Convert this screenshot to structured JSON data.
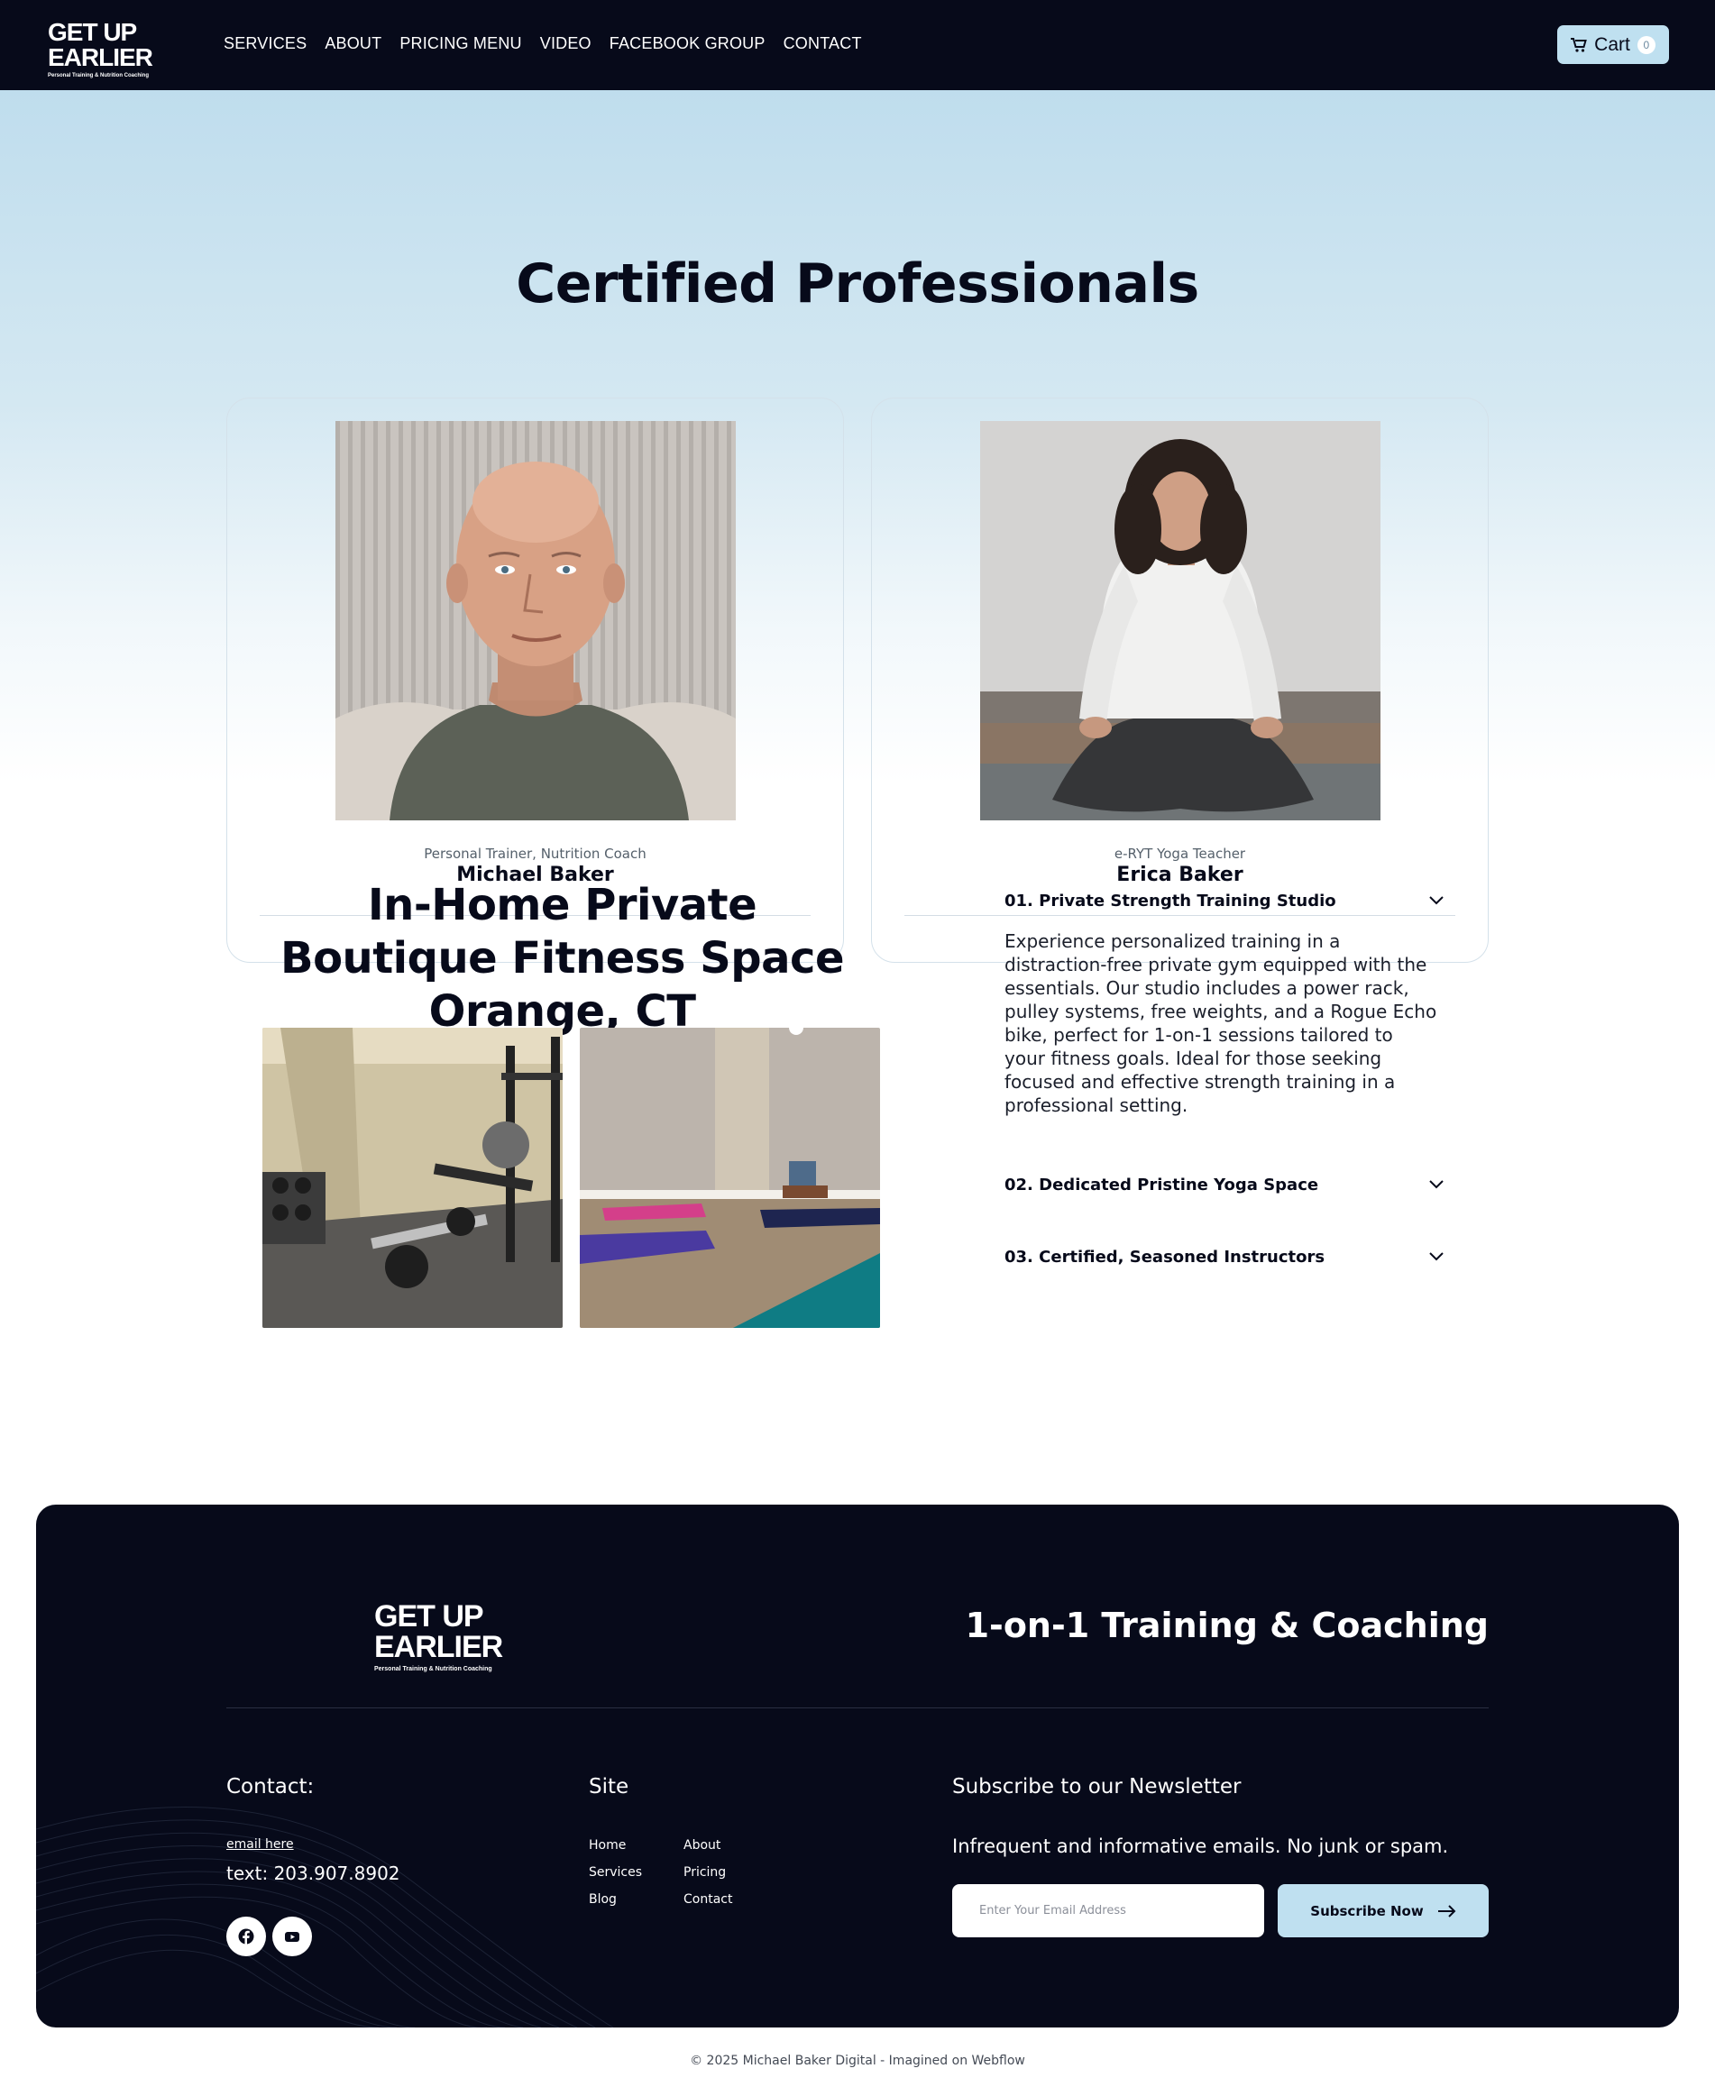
{
  "brand": {
    "logo_line1": "GET UP",
    "logo_line2": "EARLIER",
    "logo_tagline": "Personal Training & Nutrition Coaching"
  },
  "nav": {
    "items": [
      "SERVICES",
      "ABOUT",
      "PRICING MENU",
      "VIDEO",
      "FACEBOOK GROUP",
      "CONTACT"
    ],
    "cart_label": "Cart",
    "cart_count": "0"
  },
  "hero": {
    "title": "Certified Professionals",
    "cards": [
      {
        "role": "Personal Trainer, Nutrition Coach",
        "name": "Michael Baker"
      },
      {
        "role": "e-RYT Yoga Teacher",
        "name": "Erica Baker"
      }
    ]
  },
  "studio": {
    "title": "In-Home Private Boutique Fitness Space Orange, CT",
    "accordion": [
      {
        "title": "01. Private Strength Training Studio",
        "body": "Experience personalized training in a distraction-free private gym equipped with the essentials. Our studio includes a power rack, pulley systems, free weights, and a Rogue Echo bike, perfect for 1-on-1 sessions tailored to your fitness goals. Ideal for those seeking focused and effective strength training in a professional setting.",
        "expanded": true
      },
      {
        "title": "02. Dedicated Pristine Yoga Space",
        "expanded": false
      },
      {
        "title": "03. Certified, Seasoned Instructors",
        "expanded": false
      }
    ]
  },
  "footer": {
    "tagline": "1-on-1 Training & Coaching",
    "contact_heading": "Contact:",
    "email_link": "email here",
    "phone": "text: 203.907.8902",
    "site_heading": "Site",
    "site_links_col1": [
      "Home",
      "Services",
      "Blog"
    ],
    "site_links_col2": [
      "About",
      "Pricing",
      "Contact"
    ],
    "newsletter_heading": "Subscribe to our Newsletter",
    "newsletter_sub": "Infrequent and informative emails. No junk or spam.",
    "email_placeholder": "Enter Your Email Address",
    "subscribe_label": "Subscribe Now"
  },
  "copyright": "© 2025 Michael Baker Digital - Imagined on Webflow",
  "colors": {
    "navy": "#070a1a",
    "accent_light_blue": "#bfe0f0"
  }
}
